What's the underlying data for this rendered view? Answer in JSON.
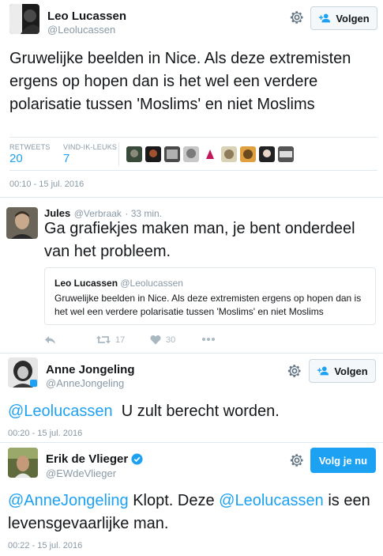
{
  "tweet1": {
    "name": "Leo Lucassen",
    "handle": "@Leolucassen",
    "follow_label": "Volgen",
    "text": "Gruwelijke beelden in Nice. Als deze extremisten ergens op hopen dan is het wel een verdere polarisatie tussen 'Moslims' en niet Moslims",
    "retweets_label": "RETWEETS",
    "retweets_count": "20",
    "likes_label": "VIND-IK-LEUKS",
    "likes_count": "7",
    "timestamp": "00:10 - 15 jul. 2016"
  },
  "reply": {
    "name": "Jules",
    "handle": "@Verbraak",
    "time": "· 33 min.",
    "text": "Ga grafiekjes maken man, je bent onderdeel van het probleem.",
    "quote_name": "Leo Lucassen",
    "quote_handle": "@Leolucassen",
    "quote_text": "Gruwelijke beelden in Nice. Als deze extremisten ergens op hopen dan is het wel een verdere polarisatie tussen 'Moslims' en niet Moslims",
    "retweet_count": "17",
    "like_count": "30"
  },
  "tweet2": {
    "name": "Anne Jongeling",
    "handle": "@AnneJongeling",
    "follow_label": "Volgen",
    "mention": "@Leolucassen",
    "text": "U zult berecht worden.",
    "timestamp": "00:20 - 15 jul. 2016"
  },
  "tweet3": {
    "name": "Erik de Vlieger",
    "handle": "@EWdeVlieger",
    "following_label": "Volg je nu",
    "mention1": "@AnneJongeling",
    "text1": "Klopt.  Deze",
    "mention2": "@Leolucassen",
    "text2": "is een levensgevaarlijke man.",
    "timestamp": "00:22 - 15 jul. 2016"
  },
  "colors": {
    "accent": "#1da1f2",
    "muted": "#8899a6",
    "verified": "#1da1f2"
  }
}
